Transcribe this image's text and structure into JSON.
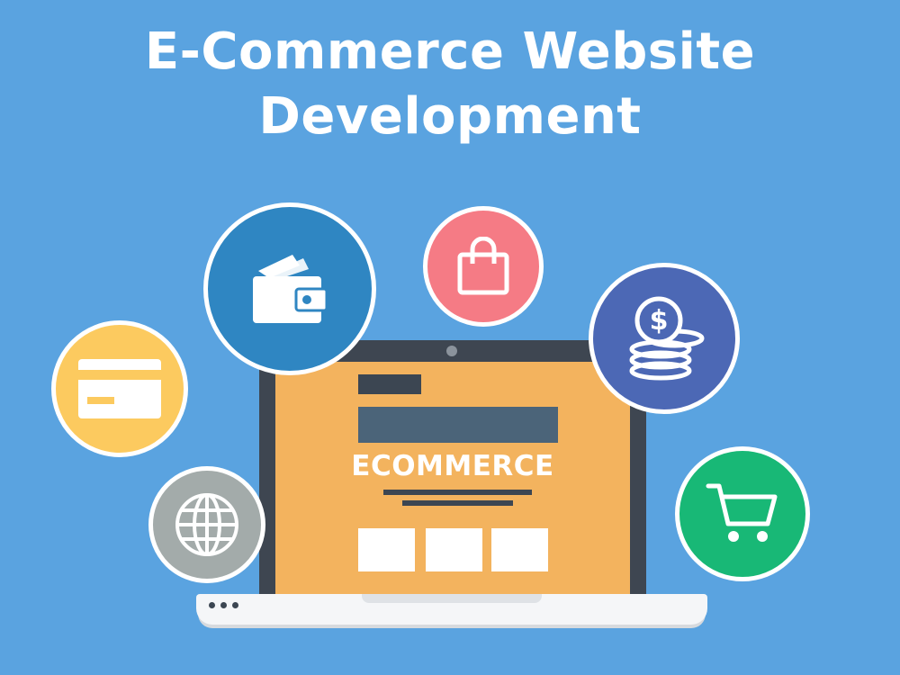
{
  "title": {
    "line1": "E-Commerce Website",
    "line2": "Development"
  },
  "laptop": {
    "screen_text": "ECOMMERCE"
  },
  "icons": [
    {
      "name": "credit-card-icon",
      "bg": "#fcca5f"
    },
    {
      "name": "wallet-icon",
      "bg": "#2f86c2"
    },
    {
      "name": "shopping-bag-icon",
      "bg": "#f57b85"
    },
    {
      "name": "coin-stack-dollar-icon",
      "bg": "#4c68b5"
    },
    {
      "name": "globe-icon",
      "bg": "#a3abaa"
    },
    {
      "name": "shopping-cart-icon",
      "bg": "#18b876"
    }
  ],
  "colors": {
    "background": "#5aa3e0",
    "screen": "#f3b35e",
    "laptop_frame": "#3e4651"
  }
}
